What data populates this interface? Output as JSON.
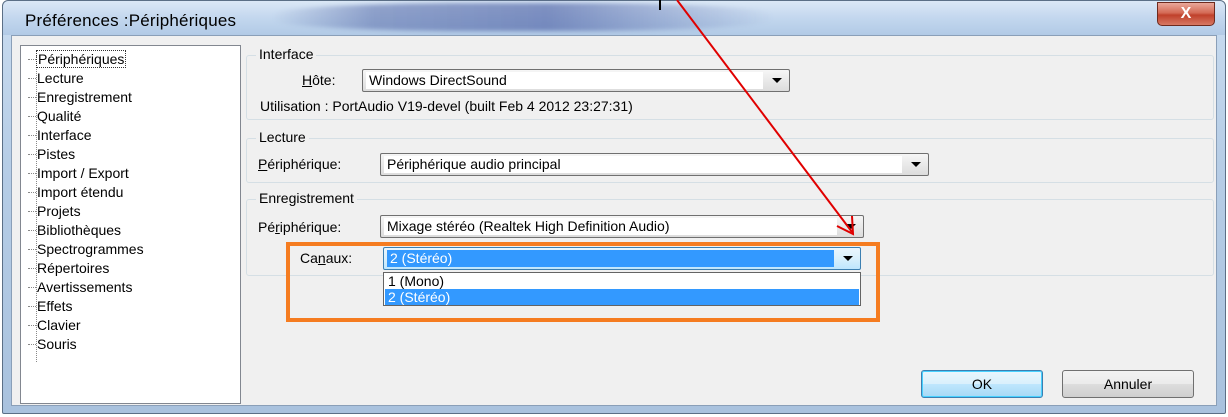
{
  "window": {
    "title": "Préférences :Périphériques",
    "close_glyph": "X"
  },
  "tree": {
    "items": [
      {
        "label": "Périphériques",
        "selected": true
      },
      {
        "label": "Lecture"
      },
      {
        "label": "Enregistrement"
      },
      {
        "label": "Qualité"
      },
      {
        "label": "Interface"
      },
      {
        "label": "Pistes"
      },
      {
        "label": "Import / Export"
      },
      {
        "label": "Import étendu"
      },
      {
        "label": "Projets"
      },
      {
        "label": "Bibliothèques"
      },
      {
        "label": "Spectrogrammes"
      },
      {
        "label": "Répertoires"
      },
      {
        "label": "Avertissements"
      },
      {
        "label": "Effets"
      },
      {
        "label": "Clavier"
      },
      {
        "label": "Souris"
      }
    ]
  },
  "interface": {
    "group_label": "Interface",
    "host_label_u": "H",
    "host_label_rest": "ôte:",
    "host_value": "Windows DirectSound",
    "usage_text": "Utilisation : PortAudio V19-devel (built Feb  4 2012 23:27:31)"
  },
  "playback": {
    "group_label": "Lecture",
    "device_label_u": "P",
    "device_label_rest": "ériphérique:",
    "device_value": "Périphérique audio principal"
  },
  "recording": {
    "group_label": "Enregistrement",
    "device_label_pre": "Pé",
    "device_label_u": "r",
    "device_label_rest": "iphérique:",
    "device_value": "Mixage stéréo (Realtek High Definition Audio)",
    "channels_label_pre": "Ca",
    "channels_label_u": "n",
    "channels_label_rest": "aux:",
    "channels_value": "2 (Stéréo)",
    "channels_options": [
      "1 (Mono)",
      "2 (Stéréo)"
    ]
  },
  "buttons": {
    "ok": "OK",
    "cancel": "Annuler"
  },
  "colors": {
    "highlight_box": "#f57c20",
    "annotation_arrow": "#e00000",
    "selection": "#3399ff"
  }
}
